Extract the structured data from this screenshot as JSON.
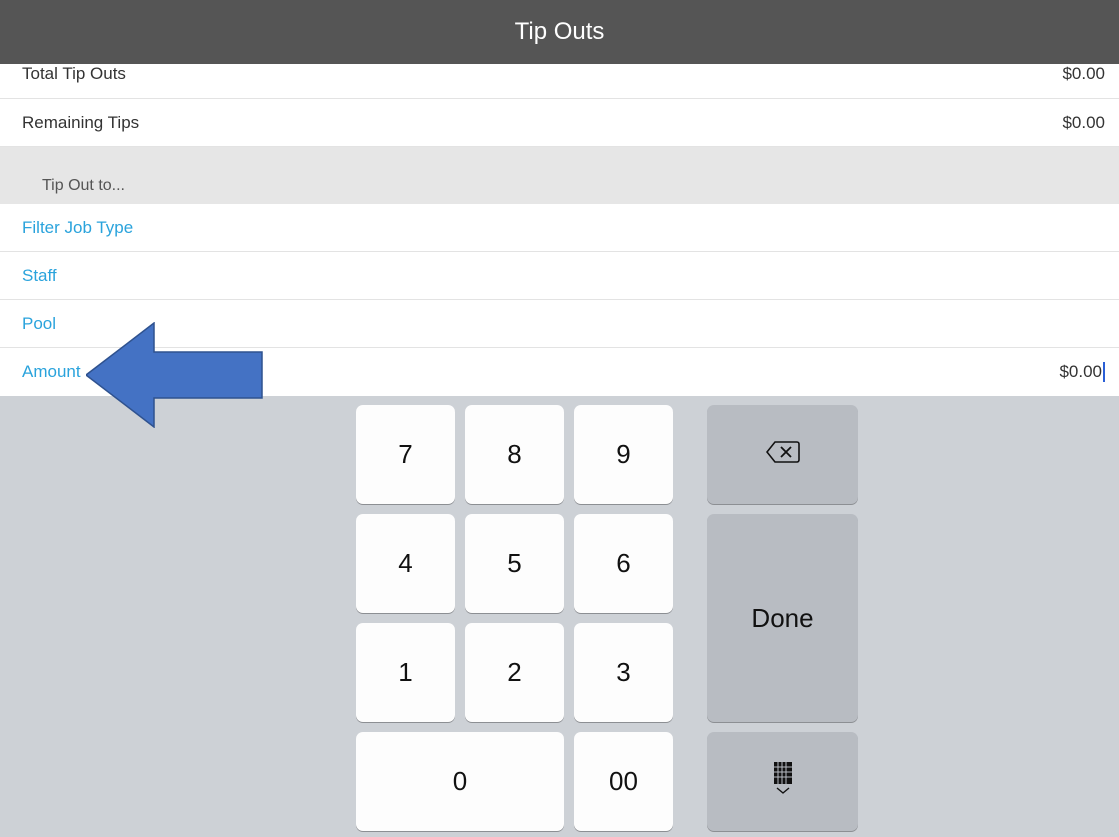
{
  "header": {
    "title": "Tip Outs"
  },
  "summary": [
    {
      "label": "Total Tip Outs",
      "value": "$0.00"
    },
    {
      "label": "Remaining Tips",
      "value": "$0.00"
    }
  ],
  "section_header": "Tip Out to...",
  "options": [
    {
      "label": "Filter Job Type"
    },
    {
      "label": "Staff"
    },
    {
      "label": "Pool"
    }
  ],
  "amount": {
    "label": "Amount",
    "value": "$0.00"
  },
  "keypad": {
    "keys": [
      "7",
      "8",
      "9",
      "4",
      "5",
      "6",
      "1",
      "2",
      "3",
      "0",
      "00"
    ],
    "done_label": "Done",
    "backspace_icon": "backspace-icon",
    "dismiss_icon": "keyboard-dismiss-icon"
  },
  "annotation": {
    "arrow_color": "#4472c4",
    "arrow_icon": "left-arrow-icon"
  },
  "colors": {
    "header_bg": "#555555",
    "link": "#2aa3dc",
    "keyboard_bg": "#cdd1d6"
  }
}
